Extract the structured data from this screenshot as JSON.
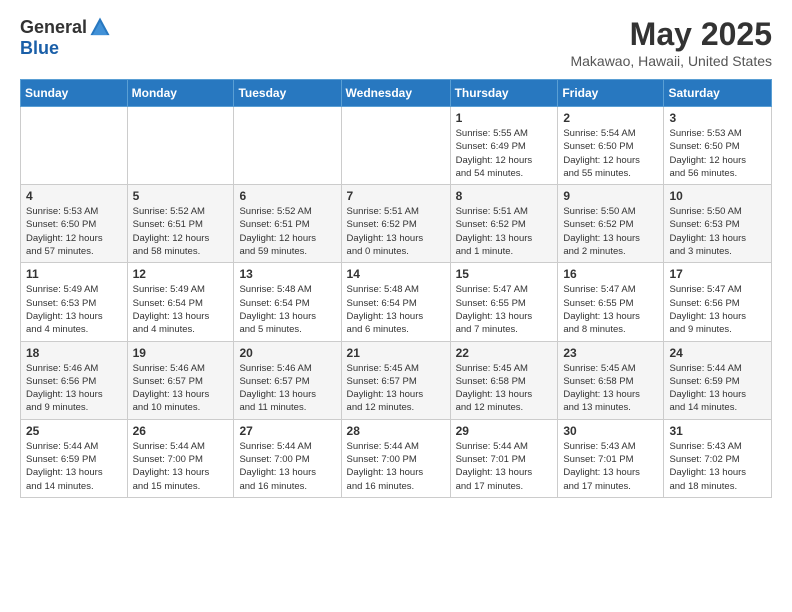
{
  "logo": {
    "general": "General",
    "blue": "Blue"
  },
  "title": "May 2025",
  "subtitle": "Makawao, Hawaii, United States",
  "headers": [
    "Sunday",
    "Monday",
    "Tuesday",
    "Wednesday",
    "Thursday",
    "Friday",
    "Saturday"
  ],
  "weeks": [
    [
      {
        "day": "",
        "info": ""
      },
      {
        "day": "",
        "info": ""
      },
      {
        "day": "",
        "info": ""
      },
      {
        "day": "",
        "info": ""
      },
      {
        "day": "1",
        "info": "Sunrise: 5:55 AM\nSunset: 6:49 PM\nDaylight: 12 hours\nand 54 minutes."
      },
      {
        "day": "2",
        "info": "Sunrise: 5:54 AM\nSunset: 6:50 PM\nDaylight: 12 hours\nand 55 minutes."
      },
      {
        "day": "3",
        "info": "Sunrise: 5:53 AM\nSunset: 6:50 PM\nDaylight: 12 hours\nand 56 minutes."
      }
    ],
    [
      {
        "day": "4",
        "info": "Sunrise: 5:53 AM\nSunset: 6:50 PM\nDaylight: 12 hours\nand 57 minutes."
      },
      {
        "day": "5",
        "info": "Sunrise: 5:52 AM\nSunset: 6:51 PM\nDaylight: 12 hours\nand 58 minutes."
      },
      {
        "day": "6",
        "info": "Sunrise: 5:52 AM\nSunset: 6:51 PM\nDaylight: 12 hours\nand 59 minutes."
      },
      {
        "day": "7",
        "info": "Sunrise: 5:51 AM\nSunset: 6:52 PM\nDaylight: 13 hours\nand 0 minutes."
      },
      {
        "day": "8",
        "info": "Sunrise: 5:51 AM\nSunset: 6:52 PM\nDaylight: 13 hours\nand 1 minute."
      },
      {
        "day": "9",
        "info": "Sunrise: 5:50 AM\nSunset: 6:52 PM\nDaylight: 13 hours\nand 2 minutes."
      },
      {
        "day": "10",
        "info": "Sunrise: 5:50 AM\nSunset: 6:53 PM\nDaylight: 13 hours\nand 3 minutes."
      }
    ],
    [
      {
        "day": "11",
        "info": "Sunrise: 5:49 AM\nSunset: 6:53 PM\nDaylight: 13 hours\nand 4 minutes."
      },
      {
        "day": "12",
        "info": "Sunrise: 5:49 AM\nSunset: 6:54 PM\nDaylight: 13 hours\nand 4 minutes."
      },
      {
        "day": "13",
        "info": "Sunrise: 5:48 AM\nSunset: 6:54 PM\nDaylight: 13 hours\nand 5 minutes."
      },
      {
        "day": "14",
        "info": "Sunrise: 5:48 AM\nSunset: 6:54 PM\nDaylight: 13 hours\nand 6 minutes."
      },
      {
        "day": "15",
        "info": "Sunrise: 5:47 AM\nSunset: 6:55 PM\nDaylight: 13 hours\nand 7 minutes."
      },
      {
        "day": "16",
        "info": "Sunrise: 5:47 AM\nSunset: 6:55 PM\nDaylight: 13 hours\nand 8 minutes."
      },
      {
        "day": "17",
        "info": "Sunrise: 5:47 AM\nSunset: 6:56 PM\nDaylight: 13 hours\nand 9 minutes."
      }
    ],
    [
      {
        "day": "18",
        "info": "Sunrise: 5:46 AM\nSunset: 6:56 PM\nDaylight: 13 hours\nand 9 minutes."
      },
      {
        "day": "19",
        "info": "Sunrise: 5:46 AM\nSunset: 6:57 PM\nDaylight: 13 hours\nand 10 minutes."
      },
      {
        "day": "20",
        "info": "Sunrise: 5:46 AM\nSunset: 6:57 PM\nDaylight: 13 hours\nand 11 minutes."
      },
      {
        "day": "21",
        "info": "Sunrise: 5:45 AM\nSunset: 6:57 PM\nDaylight: 13 hours\nand 12 minutes."
      },
      {
        "day": "22",
        "info": "Sunrise: 5:45 AM\nSunset: 6:58 PM\nDaylight: 13 hours\nand 12 minutes."
      },
      {
        "day": "23",
        "info": "Sunrise: 5:45 AM\nSunset: 6:58 PM\nDaylight: 13 hours\nand 13 minutes."
      },
      {
        "day": "24",
        "info": "Sunrise: 5:44 AM\nSunset: 6:59 PM\nDaylight: 13 hours\nand 14 minutes."
      }
    ],
    [
      {
        "day": "25",
        "info": "Sunrise: 5:44 AM\nSunset: 6:59 PM\nDaylight: 13 hours\nand 14 minutes."
      },
      {
        "day": "26",
        "info": "Sunrise: 5:44 AM\nSunset: 7:00 PM\nDaylight: 13 hours\nand 15 minutes."
      },
      {
        "day": "27",
        "info": "Sunrise: 5:44 AM\nSunset: 7:00 PM\nDaylight: 13 hours\nand 16 minutes."
      },
      {
        "day": "28",
        "info": "Sunrise: 5:44 AM\nSunset: 7:00 PM\nDaylight: 13 hours\nand 16 minutes."
      },
      {
        "day": "29",
        "info": "Sunrise: 5:44 AM\nSunset: 7:01 PM\nDaylight: 13 hours\nand 17 minutes."
      },
      {
        "day": "30",
        "info": "Sunrise: 5:43 AM\nSunset: 7:01 PM\nDaylight: 13 hours\nand 17 minutes."
      },
      {
        "day": "31",
        "info": "Sunrise: 5:43 AM\nSunset: 7:02 PM\nDaylight: 13 hours\nand 18 minutes."
      }
    ]
  ]
}
